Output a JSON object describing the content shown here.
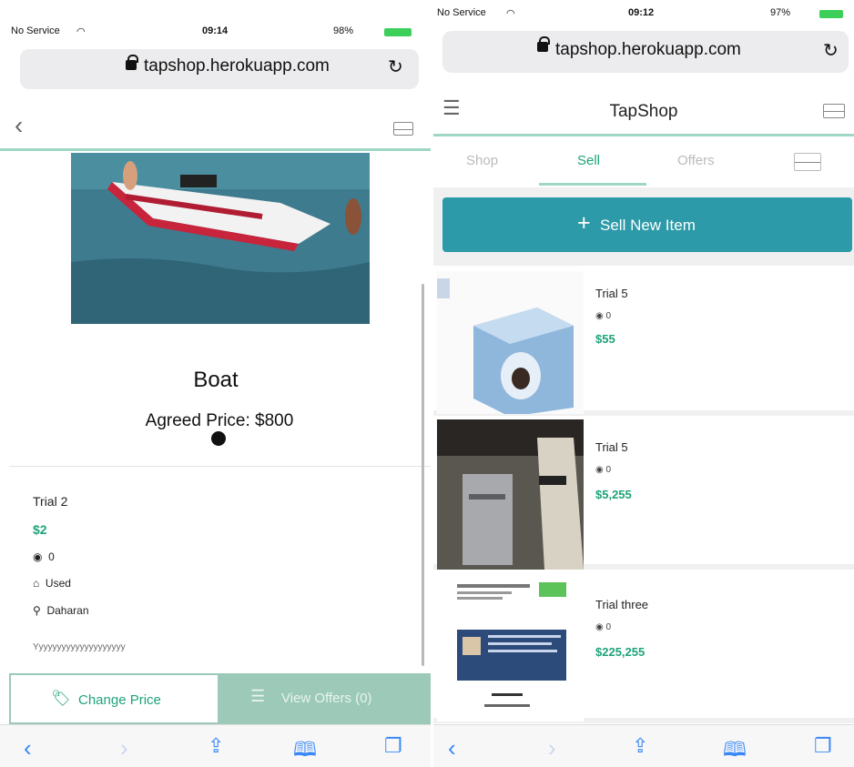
{
  "left": {
    "status": {
      "carrier": "No Service",
      "time": "09:14",
      "battery": "98%"
    },
    "url": "tapshop.herokuapp.com",
    "item": {
      "name": "Boat",
      "agreed_price": "Agreed Price: $800",
      "title": "Trial 2",
      "price": "$2",
      "views": "0",
      "condition": "Used",
      "location": "Daharan",
      "description": "Yyyyyyyyyyyyyyyyyyyy"
    },
    "actions": {
      "change_price": "Change Price",
      "view_offers": "View Offers (0)"
    }
  },
  "right": {
    "status": {
      "carrier": "No Service",
      "time": "09:12",
      "battery": "97%"
    },
    "url": "tapshop.herokuapp.com",
    "app_title": "TapShop",
    "tabs": [
      {
        "label": "Shop"
      },
      {
        "label": "Sell"
      },
      {
        "label": "Offers"
      }
    ],
    "sell_button": "Sell New Item",
    "items": [
      {
        "title": "Trial 5",
        "views": "0",
        "price": "$55"
      },
      {
        "title": "Trial 5",
        "views": "0",
        "price": "$5,255"
      },
      {
        "title": "Trial three",
        "views": "0",
        "price": "$225,255"
      }
    ]
  },
  "colors": {
    "accent": "#2c9aa8",
    "price": "#1fa37a",
    "tab_underline": "#9fd7c5",
    "offers_bg": "#9cc9b8"
  }
}
